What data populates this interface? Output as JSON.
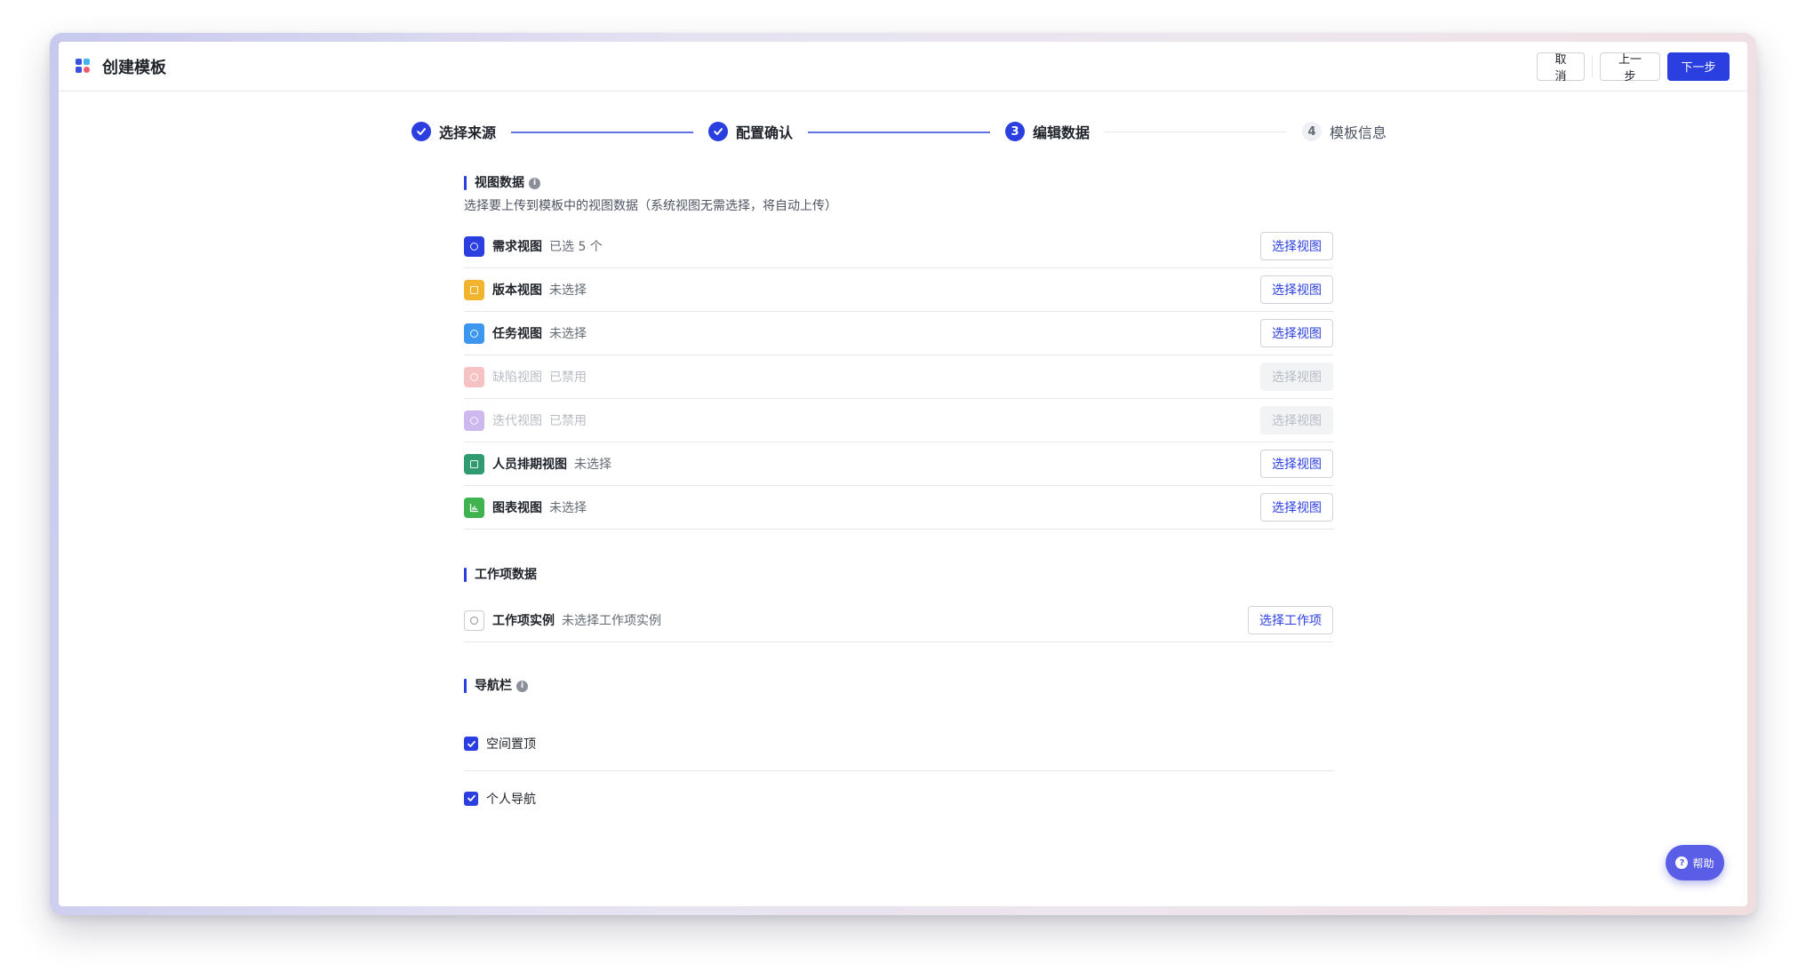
{
  "window": {
    "title": "创建模板"
  },
  "toolbar": {
    "cancel_label": "取消",
    "prev_label": "上一步",
    "next_label": "下一步"
  },
  "steps": [
    {
      "label": "选择来源",
      "number": "1",
      "status": "done"
    },
    {
      "label": "配置确认",
      "number": "2",
      "status": "done"
    },
    {
      "label": "编辑数据",
      "number": "3",
      "status": "active"
    },
    {
      "label": "模板信息",
      "number": "4",
      "status": "todo"
    }
  ],
  "views_section": {
    "title": "视图数据",
    "description": "选择要上传到模板中的视图数据（系统视图无需选择，将自动上传）",
    "items": [
      {
        "name": "需求视图",
        "status": "已选 5 个",
        "button": "选择视图",
        "color": "#2b3fe0",
        "disabled": false
      },
      {
        "name": "版本视图",
        "status": "未选择",
        "button": "选择视图",
        "color": "#f2b32f",
        "disabled": false
      },
      {
        "name": "任务视图",
        "status": "未选择",
        "button": "选择视图",
        "color": "#3e97ee",
        "disabled": false
      },
      {
        "name": "缺陷视图",
        "status": "已禁用",
        "button": "选择视图",
        "color": "#f7c2c4",
        "disabled": true
      },
      {
        "name": "迭代视图",
        "status": "已禁用",
        "button": "选择视图",
        "color": "#cdb9ee",
        "disabled": true
      },
      {
        "name": "人员排期视图",
        "status": "未选择",
        "button": "选择视图",
        "color": "#2f9b6e",
        "disabled": false
      },
      {
        "name": "图表视图",
        "status": "未选择",
        "button": "选择视图",
        "color": "#3fb34f",
        "disabled": false
      }
    ]
  },
  "work_section": {
    "title": "工作项数据",
    "item": {
      "name": "工作项实例",
      "status": "未选择工作项实例",
      "button": "选择工作项"
    }
  },
  "nav_section": {
    "title": "导航栏",
    "items": [
      {
        "label": "空间置顶",
        "checked": true
      },
      {
        "label": "个人导航",
        "checked": true
      }
    ]
  },
  "help": {
    "label": "帮助"
  },
  "colors": {
    "accent": "#2b3fe0",
    "help": "#5a5ee6"
  }
}
